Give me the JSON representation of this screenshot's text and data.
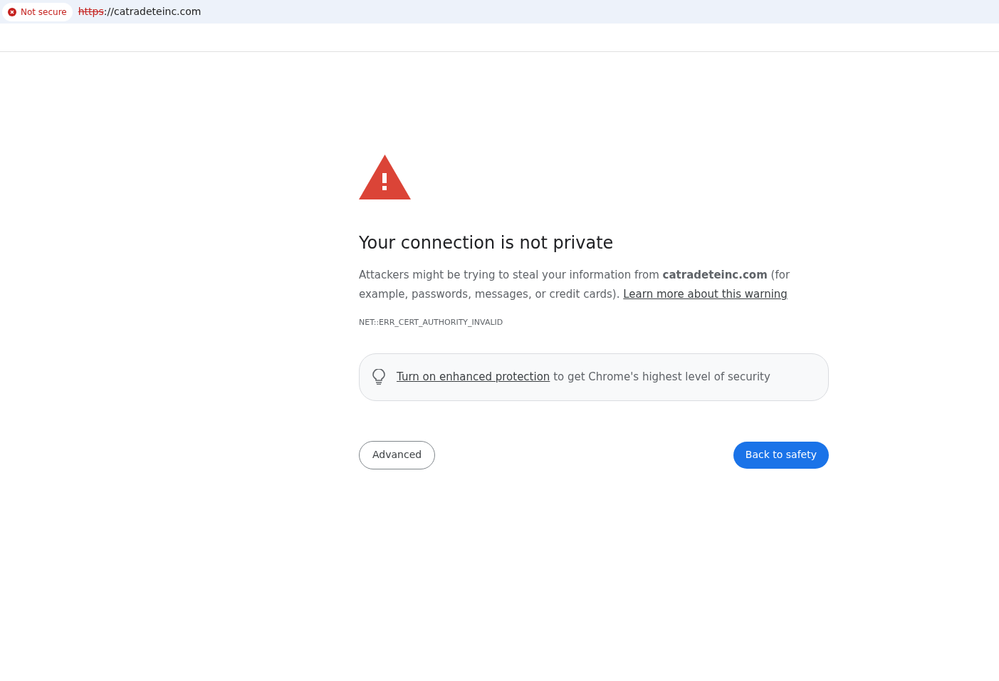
{
  "address_bar": {
    "security_chip": "Not secure",
    "url_scheme": "https",
    "url_rest": "://catradeteinc.com"
  },
  "interstitial": {
    "title": "Your connection is not private",
    "message": "Attackers might be trying to steal your information from **catradeteinc.com** (for example, passwords, messages, or credit cards).",
    "message_link": "Learn more about this warning",
    "error_code": "NET::ERR_CERT_AUTHORITY_INVALID",
    "hint_link": "Turn on enhanced protection",
    "hint_text": "to get Chrome's highest level of security",
    "buttons": [
      {
        "label": "Advanced",
        "kind": "secondary"
      },
      {
        "label": "Back to safety",
        "kind": "primary"
      }
    ]
  }
}
